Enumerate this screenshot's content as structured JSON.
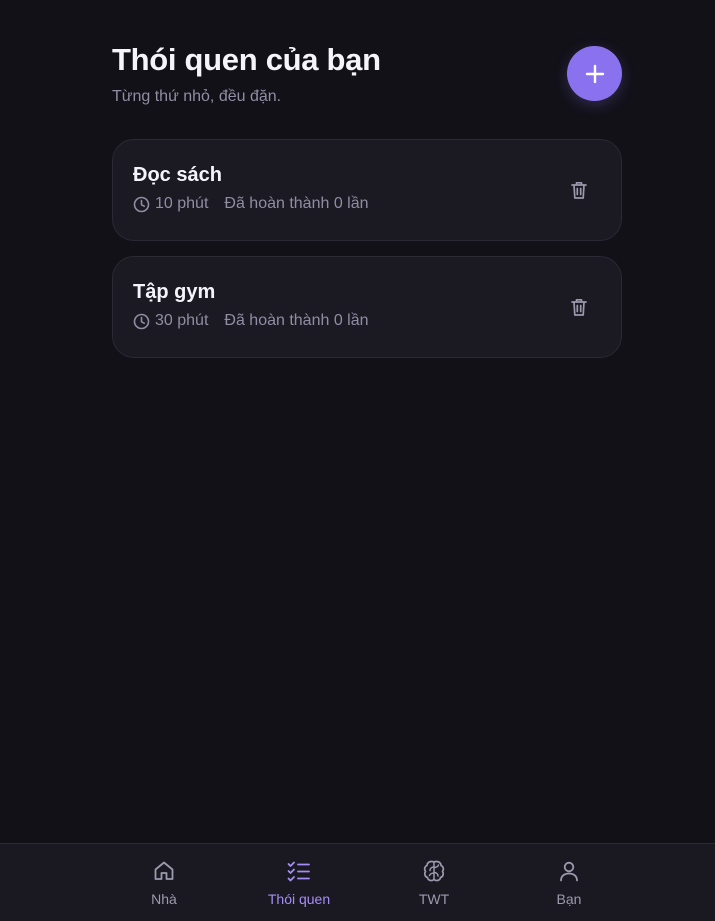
{
  "header": {
    "title": "Thói quen của bạn",
    "subtitle": "Từng thứ nhỏ, đều đặn.",
    "add_icon": "plus-icon"
  },
  "habits": [
    {
      "name": "Đọc sách",
      "duration": "10 phút",
      "completed": "Đã hoàn thành 0 lần",
      "duration_icon": "clock-icon",
      "delete_icon": "trash-icon"
    },
    {
      "name": "Tập gym",
      "duration": "30 phút",
      "completed": "Đã hoàn thành 0 lần",
      "duration_icon": "clock-icon",
      "delete_icon": "trash-icon"
    }
  ],
  "nav": {
    "active": "Thói quen",
    "items": [
      {
        "label": "Nhà",
        "icon": "home-icon"
      },
      {
        "label": "Thói quen",
        "icon": "checklist-icon"
      },
      {
        "label": "TWT",
        "icon": "brain-icon"
      },
      {
        "label": "Bạn",
        "icon": "user-icon"
      }
    ]
  },
  "colors": {
    "background": "#121118",
    "card": "#1b1a23",
    "accent": "#8a72ee",
    "active_nav": "#a48df6",
    "muted_text": "#8f8da3"
  }
}
